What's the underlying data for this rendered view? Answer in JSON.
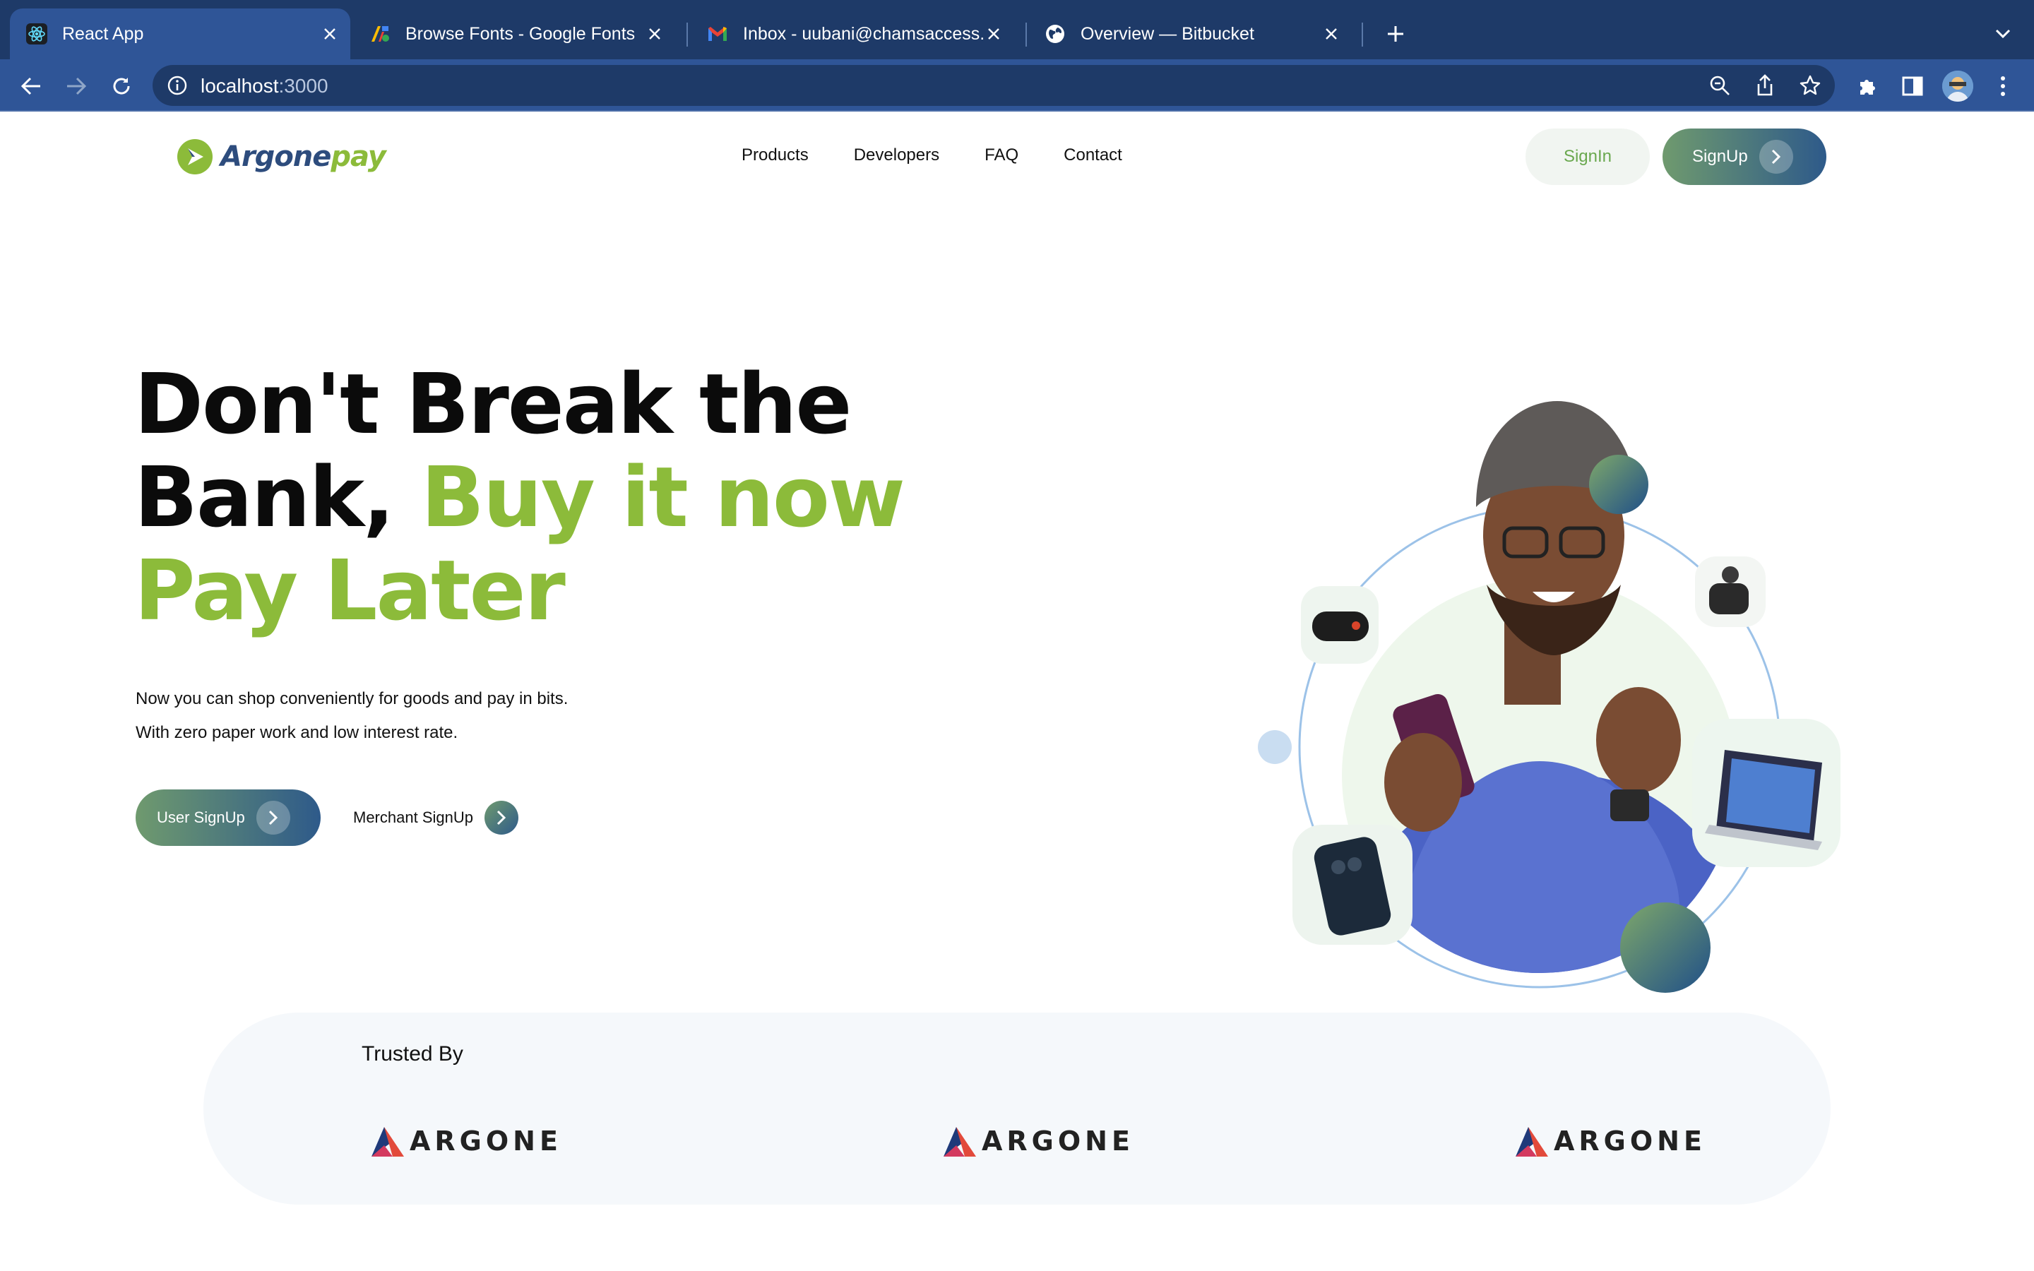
{
  "browser": {
    "tabs": [
      {
        "title": "React App",
        "active": true,
        "icon": "react-icon"
      },
      {
        "title": "Browse Fonts - Google Fonts",
        "active": false,
        "icon": "google-fonts-icon"
      },
      {
        "title": "Inbox - uubani@chamsaccess.c",
        "active": false,
        "icon": "gmail-icon"
      },
      {
        "title": "Overview — Bitbucket",
        "active": false,
        "icon": "globe-icon"
      }
    ],
    "url_host": "localhost",
    "url_port": ":3000"
  },
  "site": {
    "logo": {
      "part1": "Argone",
      "part2": "pay"
    },
    "nav": [
      "Products",
      "Developers",
      "FAQ",
      "Contact"
    ],
    "signin_label": "SignIn",
    "signup_label": "SignUp"
  },
  "hero": {
    "line1": "Don't Break the",
    "line2_black": "Bank,",
    "line2_green": "Buy it now",
    "line3_green": "Pay Later",
    "sub1": "Now you can shop conveniently for goods and pay in bits.",
    "sub2": "With zero paper work and low interest rate.",
    "user_signup": "User SignUp",
    "merchant_signup": "Merchant SignUp"
  },
  "trusted": {
    "title": "Trusted By",
    "brands": [
      "ARGONE",
      "ARGONE",
      "ARGONE"
    ]
  },
  "colors": {
    "chrome_dark": "#1e3a68",
    "chrome_light": "#2f5597",
    "brand_green": "#8cbb3a",
    "brand_blue": "#2d4c7d"
  }
}
